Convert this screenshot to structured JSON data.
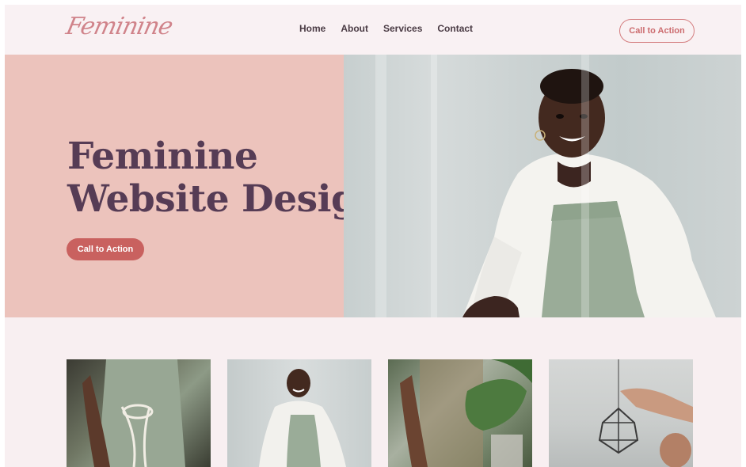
{
  "header": {
    "logo_text": "Feminine",
    "nav": [
      "Home",
      "About",
      "Services",
      "Contact"
    ],
    "cta_label": "Call to Action"
  },
  "hero": {
    "title_line1": "Feminine",
    "title_line2": "Website Design",
    "cta_label": "Call to Action",
    "photo": "woman-in-apron-photo"
  },
  "gallery": [
    {
      "photo": "apron-torso-photo"
    },
    {
      "photo": "woman-kneeling-photo"
    },
    {
      "photo": "plant-pot-photo"
    },
    {
      "photo": "pendant-lamp-photo"
    }
  ],
  "colors": {
    "hero_panel": "#ecc3bc",
    "title": "#563c55",
    "accent": "#c9615f",
    "background": "#f8eff1"
  }
}
